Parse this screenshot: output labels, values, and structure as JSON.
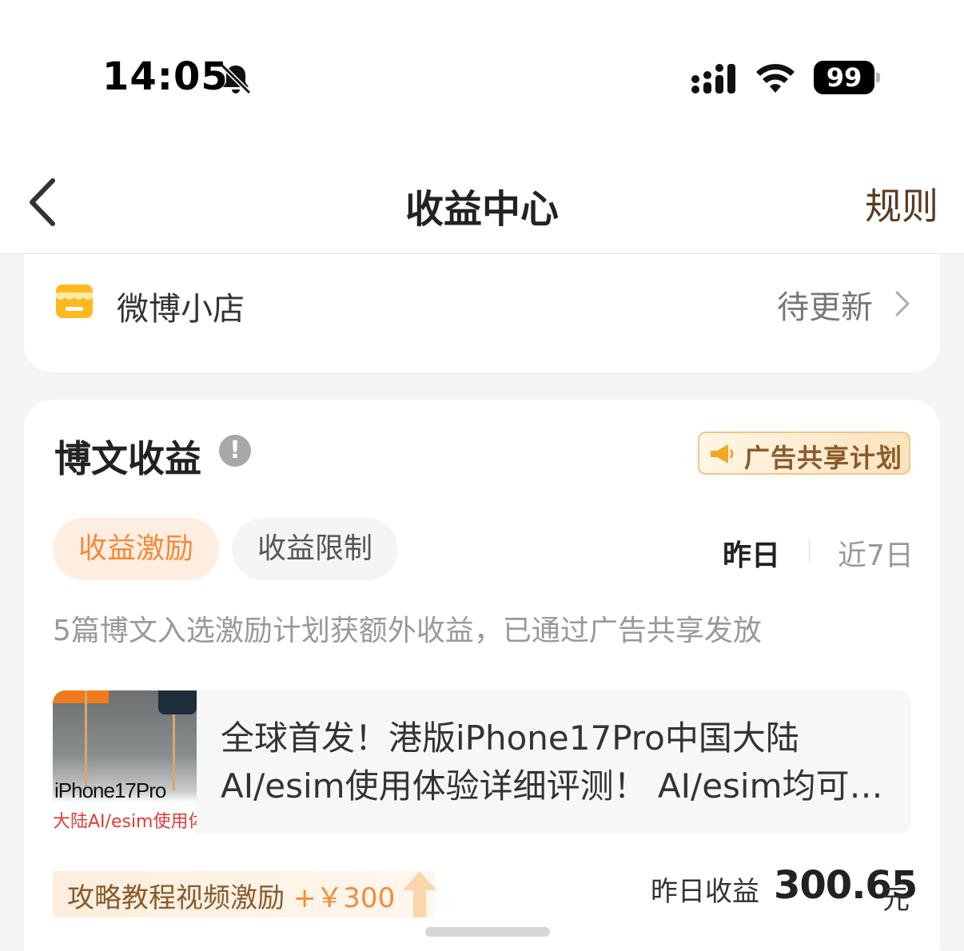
{
  "status_bar": {
    "time": "14:05",
    "icons": [
      "bell-slash-icon",
      "signal-icon",
      "wifi-icon"
    ],
    "battery": "99"
  },
  "nav": {
    "back_icon": "chevron-left-icon",
    "title": "收益中心",
    "rules": "规则"
  },
  "shop": {
    "icon": "shop-icon",
    "label": "微博小店",
    "status": "待更新"
  },
  "post_earnings": {
    "title": "博文收益",
    "info_icon": "!",
    "ad_badge": "广告共享计划",
    "tabs": [
      {
        "label": "收益激励",
        "active": true
      },
      {
        "label": "收益限制",
        "active": false
      }
    ],
    "period": {
      "yesterday": "昨日",
      "last7": "近7日",
      "selected": "昨日"
    },
    "description": "5篇博文入选激励计划获额外收益，已通过广告共享发放",
    "post": {
      "thumb_text_1": "iPhone17Pro",
      "thumb_text_2": "大陆AI/esim使用体",
      "title": "全球首发！港版iPhone17Pro中国大陆AI/esim使用体验详细评测！ AI/esim均可…"
    },
    "bonus_label": "攻略教程视频激励",
    "bonus_amount": "+￥300",
    "earnings_label": "昨日收益",
    "earnings_value": "300.65",
    "earnings_unit": "元"
  },
  "colors": {
    "accent_orange": "#f58a37",
    "brown": "#5b3a24",
    "badge_border": "#f2c58c"
  }
}
